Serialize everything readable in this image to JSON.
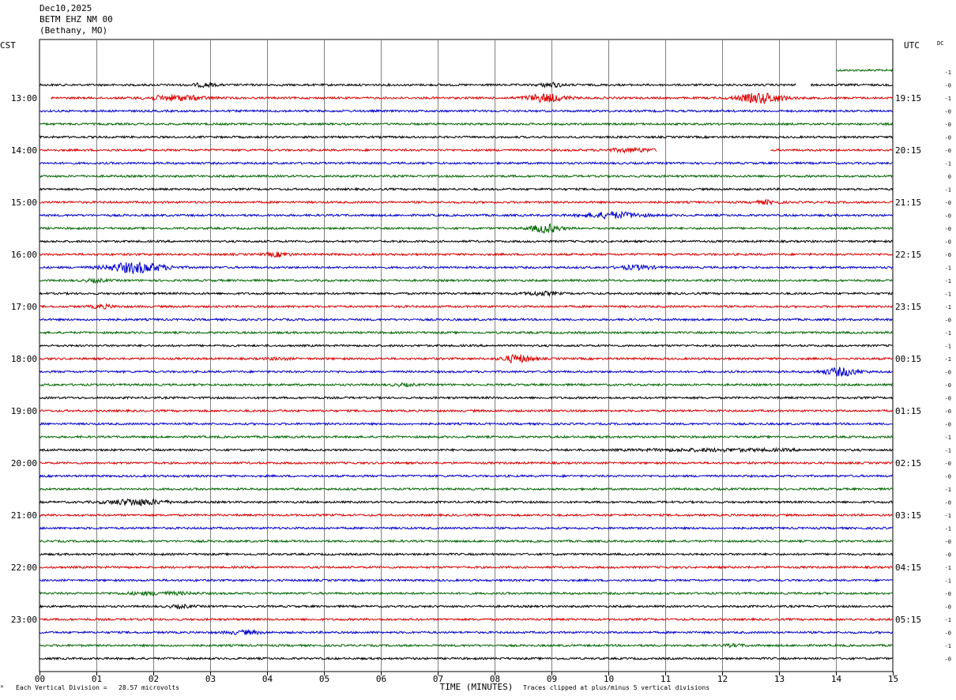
{
  "header": {
    "date": "Dec10,2025",
    "station": "BETM EHZ NM 00",
    "location": "(Bethany, MO)"
  },
  "labels": {
    "left_timezone": "CST",
    "right_timezone": "UTC",
    "dc_label": "DC"
  },
  "footer": {
    "scale_text": "Each Vertical Division =   28.57 microvolts",
    "clip_text": "Traces clipped at plus/minus 5 vertical divisions",
    "corner_mark": "ᴹ"
  },
  "chart_data": {
    "type": "line",
    "title": "",
    "xlabel": "TIME (MINUTES)",
    "ylabel": "",
    "xlim": [
      0,
      15
    ],
    "x_ticks": [
      "00",
      "01",
      "02",
      "03",
      "04",
      "05",
      "06",
      "07",
      "08",
      "09",
      "10",
      "11",
      "12",
      "13",
      "14",
      "15"
    ],
    "grid": true,
    "trace_colors": [
      "#000000",
      "#dd0000",
      "#0000cc",
      "#006600"
    ],
    "series_color_cycle_start": 3,
    "left_hour_labels": [
      "13:00",
      "14:00",
      "15:00",
      "16:00",
      "17:00",
      "18:00",
      "19:00",
      "20:00",
      "21:00",
      "22:00",
      "23:00"
    ],
    "right_hour_labels": [
      "19:15",
      "20:15",
      "21:15",
      "22:15",
      "23:15",
      "00:15",
      "01:15",
      "02:15",
      "03:15",
      "04:15",
      "05:15"
    ],
    "dc_offsets": [
      "-1",
      "-0",
      "-1",
      "-0",
      "-0",
      "-0",
      "-0",
      "-1",
      "0",
      "-1",
      "-0",
      "-0",
      "-0",
      "-0",
      "-0",
      "-1",
      "-1",
      "-1",
      "-1",
      "-0",
      "-1",
      "-1",
      "-1",
      "-0",
      "-0",
      "-0",
      "-0",
      "-0",
      "-1",
      "-1",
      "-0",
      "-0",
      "-1",
      "-0",
      "-1",
      "-1",
      "-0",
      "-0",
      "-1",
      "-1",
      "-0",
      "-0",
      "-1",
      "-0",
      "-1",
      "-0",
      "-0",
      "-1",
      "-1"
    ],
    "traces": [
      {
        "row": 0,
        "gaps": [
          [
            0,
            14.0
          ]
        ],
        "bursts": [],
        "offset_segments": [
          {
            "from": 14.0,
            "to": 15,
            "level": -1.0
          }
        ]
      },
      {
        "row": 1,
        "gaps": [
          [
            13.3,
            13.55
          ]
        ],
        "bursts": [
          {
            "center": 9.0,
            "width": 0.2,
            "amp": 0.6
          },
          {
            "center": 2.9,
            "width": 0.2,
            "amp": 0.5
          }
        ]
      },
      {
        "row": 2,
        "gaps": [
          [
            0,
            0.2
          ]
        ],
        "bursts": [
          {
            "center": 8.9,
            "width": 0.35,
            "amp": 1.2
          },
          {
            "center": 12.7,
            "width": 0.4,
            "amp": 1.5
          },
          {
            "center": 2.4,
            "width": 0.5,
            "amp": 0.8
          }
        ]
      },
      {
        "row": 3,
        "gaps": [],
        "bursts": []
      },
      {
        "row": 4,
        "gaps": [],
        "bursts": []
      },
      {
        "row": 5,
        "gaps": [],
        "bursts": []
      },
      {
        "row": 6,
        "gaps": [
          [
            10.85,
            12.85
          ]
        ],
        "bursts": [
          {
            "center": 10.4,
            "width": 0.4,
            "amp": 0.5
          }
        ]
      },
      {
        "row": 7,
        "gaps": [],
        "bursts": []
      },
      {
        "row": 8,
        "gaps": [],
        "bursts": []
      },
      {
        "row": 9,
        "gaps": [],
        "bursts": []
      },
      {
        "row": 10,
        "gaps": [],
        "bursts": [
          {
            "center": 12.8,
            "width": 0.2,
            "amp": 0.5
          }
        ]
      },
      {
        "row": 11,
        "gaps": [],
        "bursts": [
          {
            "center": 10.1,
            "width": 0.5,
            "amp": 0.9
          }
        ]
      },
      {
        "row": 12,
        "gaps": [],
        "bursts": [
          {
            "center": 8.9,
            "width": 0.25,
            "amp": 1.3
          }
        ]
      },
      {
        "row": 13,
        "gaps": [],
        "bursts": []
      },
      {
        "row": 14,
        "gaps": [],
        "bursts": [
          {
            "center": 4.2,
            "width": 0.2,
            "amp": 0.6
          }
        ]
      },
      {
        "row": 15,
        "gaps": [],
        "bursts": [
          {
            "center": 1.7,
            "width": 0.5,
            "amp": 1.6
          },
          {
            "center": 10.5,
            "width": 0.3,
            "amp": 0.6
          }
        ]
      },
      {
        "row": 16,
        "gaps": [],
        "bursts": [
          {
            "center": 1.0,
            "width": 0.2,
            "amp": 0.4
          }
        ]
      },
      {
        "row": 17,
        "gaps": [],
        "bursts": [
          {
            "center": 8.8,
            "width": 0.3,
            "amp": 0.5
          }
        ]
      },
      {
        "row": 18,
        "gaps": [],
        "bursts": [
          {
            "center": 1.1,
            "width": 0.2,
            "amp": 0.5
          }
        ]
      },
      {
        "row": 19,
        "gaps": [],
        "bursts": []
      },
      {
        "row": 20,
        "gaps": [],
        "bursts": []
      },
      {
        "row": 21,
        "gaps": [],
        "bursts": []
      },
      {
        "row": 22,
        "gaps": [],
        "bursts": [
          {
            "center": 8.4,
            "width": 0.25,
            "amp": 1.2
          },
          {
            "center": 4.2,
            "width": 0.2,
            "amp": 0.3
          }
        ]
      },
      {
        "row": 23,
        "gaps": [],
        "bursts": [
          {
            "center": 14.1,
            "width": 0.3,
            "amp": 1.2
          }
        ]
      },
      {
        "row": 24,
        "gaps": [],
        "bursts": [
          {
            "center": 6.4,
            "width": 0.2,
            "amp": 0.3
          }
        ]
      },
      {
        "row": 25,
        "gaps": [],
        "bursts": []
      },
      {
        "row": 26,
        "gaps": [],
        "bursts": []
      },
      {
        "row": 27,
        "gaps": [],
        "bursts": []
      },
      {
        "row": 28,
        "gaps": [],
        "bursts": []
      },
      {
        "row": 29,
        "gaps": [],
        "bursts": [
          {
            "center": 12.0,
            "width": 1.5,
            "amp": 0.3
          }
        ]
      },
      {
        "row": 30,
        "gaps": [],
        "bursts": []
      },
      {
        "row": 31,
        "gaps": [],
        "bursts": []
      },
      {
        "row": 32,
        "gaps": [],
        "bursts": []
      },
      {
        "row": 33,
        "gaps": [],
        "bursts": [
          {
            "center": 1.7,
            "width": 0.5,
            "amp": 0.9
          }
        ]
      },
      {
        "row": 34,
        "gaps": [],
        "bursts": []
      },
      {
        "row": 35,
        "gaps": [],
        "bursts": []
      },
      {
        "row": 36,
        "gaps": [],
        "bursts": []
      },
      {
        "row": 37,
        "gaps": [],
        "bursts": []
      },
      {
        "row": 38,
        "gaps": [],
        "bursts": []
      },
      {
        "row": 39,
        "gaps": [],
        "bursts": []
      },
      {
        "row": 40,
        "gaps": [],
        "bursts": [
          {
            "center": 2.1,
            "width": 0.6,
            "amp": 0.4
          }
        ]
      },
      {
        "row": 41,
        "gaps": [],
        "bursts": [
          {
            "center": 2.5,
            "width": 0.2,
            "amp": 0.4
          }
        ]
      },
      {
        "row": 42,
        "gaps": [],
        "bursts": []
      },
      {
        "row": 43,
        "gaps": [],
        "bursts": [
          {
            "center": 3.6,
            "width": 0.3,
            "amp": 0.5
          }
        ]
      },
      {
        "row": 44,
        "gaps": [],
        "bursts": [
          {
            "center": 12.2,
            "width": 0.2,
            "amp": 0.3
          }
        ]
      },
      {
        "row": 45,
        "gaps": [],
        "bursts": []
      }
    ]
  }
}
